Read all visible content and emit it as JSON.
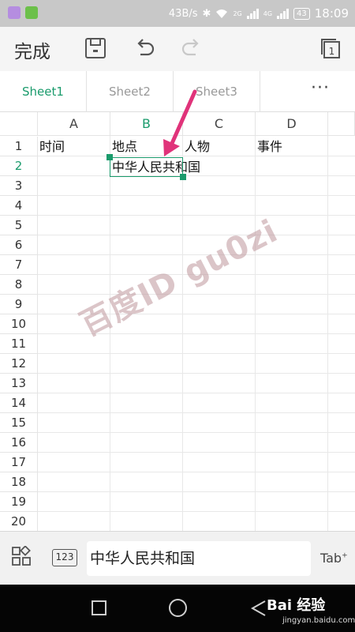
{
  "status_bar": {
    "speed": "43B/s",
    "net1": "2G",
    "net2": "4G",
    "battery": "43",
    "time": "18:09"
  },
  "toolbar": {
    "done_label": "完成"
  },
  "tabs": [
    {
      "label": "Sheet1",
      "active": true
    },
    {
      "label": "Sheet2",
      "active": false
    },
    {
      "label": "Sheet3",
      "active": false
    }
  ],
  "tabs_more": "···",
  "columns": [
    "A",
    "B",
    "C",
    "D"
  ],
  "active_column": "B",
  "rows": [
    "1",
    "2",
    "3",
    "4",
    "5",
    "6",
    "7",
    "8",
    "9",
    "10",
    "11",
    "12",
    "13",
    "14",
    "15",
    "16",
    "17",
    "18",
    "19",
    "20"
  ],
  "active_row": "2",
  "cells": {
    "A1": "时间",
    "B1": "地点",
    "C1": "人物",
    "D1": "事件",
    "B2": "中华人民共和国"
  },
  "watermark": "百度ID gu0zi",
  "input_bar": {
    "keyboard_label": "123",
    "value": "中华人民共和国",
    "tab_label": "Tab"
  },
  "branding": {
    "logo": "Bai 经验",
    "url": "jingyan.baidu.com"
  },
  "colors": {
    "accent": "#1a9b6c",
    "arrow": "#e0337a",
    "status_bar": "#c8c8c8"
  }
}
